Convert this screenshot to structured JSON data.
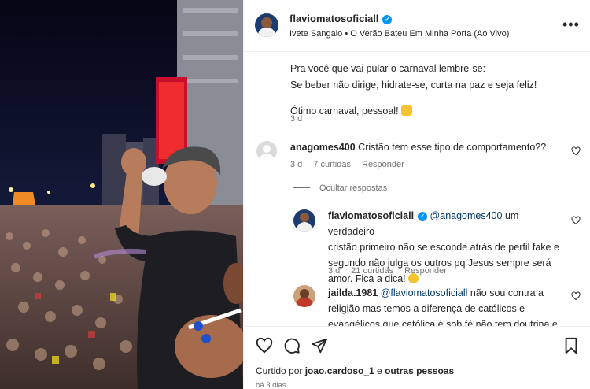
{
  "post": {
    "username": "flaviomatosoficiall",
    "song": "Ivete Sangalo • O Verão Bateu Em Minha Porta (Ao Vivo)",
    "more_icon": "more-horizontal-icon",
    "caption_line1": "Pra você que vai pular o carnaval lembre-se:",
    "caption_line2": "Se beber não dirige, hidrate-se, curta na paz e seja feliz!",
    "caption_line3": "Ótimo carnaval, pessoal!",
    "caption_time": "3 d"
  },
  "comments": [
    {
      "username": "anagomes400",
      "text": "Cristão tem esse tipo de comportamento??",
      "time": "3 d",
      "likes": "7 curtidas",
      "reply": "Responder"
    }
  ],
  "hide_replies": "Ocultar respostas",
  "replies": [
    {
      "username": "flaviomatosoficiall",
      "mention": "@anagomes400",
      "text_line1": " um verdadeiro",
      "text_line2": "cristão primeiro não se esconde atrás de perfil fake e",
      "text_line3": "segundo não julga os outros pq Jesus sempre será",
      "text_line4": "amor. Fica a dica!",
      "time": "3 d",
      "likes": "21 curtidas",
      "reply": "Responder"
    },
    {
      "username": "jailda.1981",
      "mention": "@flaviomatosoficiall",
      "text_line1": " não sou contra a",
      "text_line2": "religião mas temos a diferença de católicos e",
      "text_line3": "evangélicos que católica é sob fé não tem doutrina e"
    }
  ],
  "footer": {
    "liked_prefix": "Curtido por ",
    "liked_user": "joao.cardoso_1",
    "liked_mid": " e ",
    "liked_others": "outras pessoas",
    "ago": "há 3 dias"
  },
  "colors": {
    "verified": "#0095f6",
    "mention": "#00376b",
    "muted": "#737373"
  }
}
